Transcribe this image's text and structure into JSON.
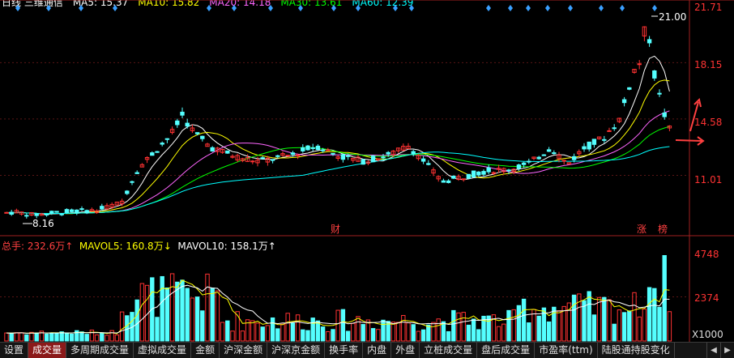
{
  "top_legend": {
    "items": [
      {
        "text": "日线 三维通信",
        "color": "#ffffff"
      },
      {
        "text": "MA5: 15.37",
        "color": "#ffffff"
      },
      {
        "text": "MA10: 15.82",
        "color": "#ffff00"
      },
      {
        "text": "MA20: 14.18",
        "color": "#ff66ff"
      },
      {
        "text": "MA30: 13.61",
        "color": "#00ff00"
      },
      {
        "text": "MA60: 12.39",
        "color": "#00ffff"
      }
    ]
  },
  "price_axis": {
    "ticks": [
      "21.71",
      "18.15",
      "14.58",
      "11.01"
    ],
    "color": "#ff3333"
  },
  "price_annotations": {
    "high": "21.00",
    "low": "8.16",
    "markers": [
      {
        "text": "财",
        "color": "#ff4040"
      },
      {
        "text": "涨",
        "color": "#ff4040"
      },
      {
        "text": "榜",
        "color": "#ff4040"
      }
    ]
  },
  "volume_legend": {
    "total": "总手: 232.6万↑",
    "mavol5": "MAVOL5: 160.8万↓",
    "mavol10": "MAVOL10: 158.1万↑"
  },
  "volume_axis": {
    "ticks": [
      "4748",
      "2374"
    ],
    "unit": "X1000"
  },
  "colors": {
    "up": "#ff3232",
    "down": "#54ffff",
    "ma5": "#ffffff",
    "ma10": "#ffff00",
    "ma20": "#ff66ff",
    "ma30": "#00ff00",
    "ma60": "#00ffff",
    "diamond": "#3aa0ff"
  },
  "bottom_tabs": [
    {
      "label": "设置",
      "active": false
    },
    {
      "label": "成交量",
      "active": true
    },
    {
      "label": "多周期成交量",
      "active": false
    },
    {
      "label": "虚拟成交量",
      "active": false
    },
    {
      "label": "金额",
      "active": false
    },
    {
      "label": "沪深金额",
      "active": false
    },
    {
      "label": "沪深京金额",
      "active": false
    },
    {
      "label": "换手率",
      "active": false
    },
    {
      "label": "内盘",
      "active": false
    },
    {
      "label": "外盘",
      "active": false
    },
    {
      "label": "立桩成交量",
      "active": false
    },
    {
      "label": "盘后成交量",
      "active": false
    },
    {
      "label": "市盈率(ttm)",
      "active": false
    },
    {
      "label": "陆股通持股变化",
      "active": false
    }
  ],
  "nav": {
    "left": "◀",
    "right": "▶"
  },
  "chart_data": {
    "type": "candlestick",
    "price_range": [
      8.16,
      21.71
    ],
    "volume_range": [
      0,
      4748
    ],
    "volume_unit": "X1000"
  }
}
